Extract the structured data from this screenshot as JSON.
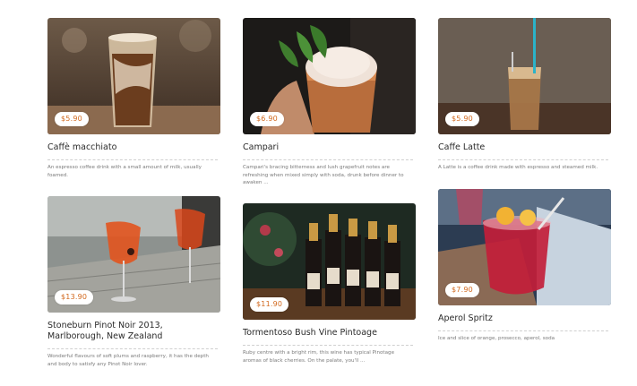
{
  "items": [
    {
      "name": "Caffè macchiato",
      "price": "$5.90",
      "description": "An espresso coffee drink with a small amount of milk, usually foamed."
    },
    {
      "name": "Campari",
      "price": "$6.90",
      "description": "Campari's bracing bitterness and lush grapefruit notes are refreshing when mixed simply with soda, drunk before dinner to awaken ..."
    },
    {
      "name": "Caffe Latte",
      "price": "$5.90",
      "description": "A Latte is a coffee drink made with espresso and steamed milk."
    },
    {
      "name": "Stoneburn Pinot Noir 2013, Marlborough, New Zealand",
      "price": "$13.90",
      "description": "Wonderful flavours of soft plums and raspberry, it has the depth and body to satisfy any Pinot Noir lover."
    },
    {
      "name": "Tormentoso Bush Vine Pintoage",
      "price": "$11.90",
      "description": "Ruby centre with a bright rim, this wine has typical Pinotage aromas of black cherries. On the palate, you'll ..."
    },
    {
      "name": "Aperol Spritz",
      "price": "$7.90",
      "description": "Ice and slice of orange, prosecco, aperol, soda"
    }
  ]
}
